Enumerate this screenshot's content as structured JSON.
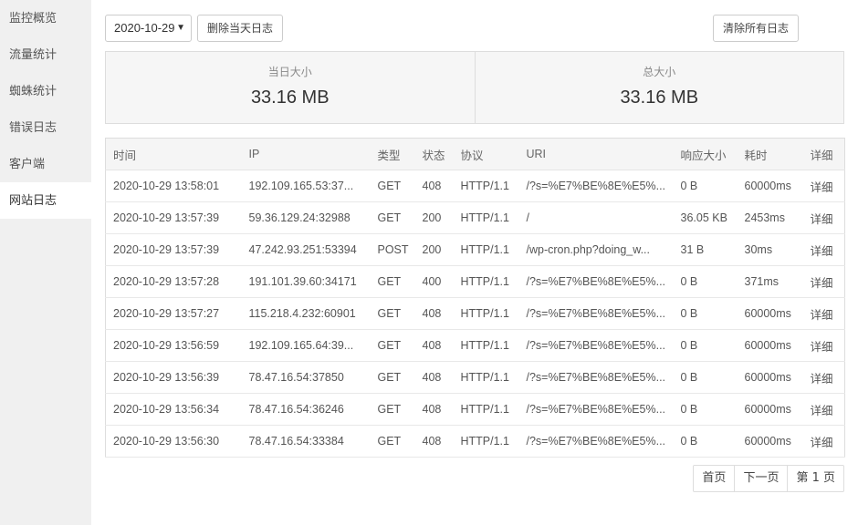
{
  "sidebar": {
    "items": [
      {
        "label": "监控概览"
      },
      {
        "label": "流量统计"
      },
      {
        "label": "蜘蛛统计"
      },
      {
        "label": "错误日志"
      },
      {
        "label": "客户端"
      },
      {
        "label": "网站日志"
      }
    ],
    "active_index": 5
  },
  "toolbar": {
    "date_value": "2020-10-29",
    "delete_today_label": "删除当天日志",
    "clear_all_label": "清除所有日志"
  },
  "stats": {
    "today_label": "当日大小",
    "today_value": "33.16 MB",
    "total_label": "总大小",
    "total_value": "33.16 MB"
  },
  "table": {
    "headers": [
      "时间",
      "IP",
      "类型",
      "状态",
      "协议",
      "URI",
      "响应大小",
      "耗时",
      "详细"
    ],
    "rows": [
      [
        "2020-10-29 13:58:01",
        "192.109.165.53:37...",
        "GET",
        "408",
        "HTTP/1.1",
        "/?s=%E7%BE%8E%E5%...",
        "0 B",
        "60000ms",
        "详细"
      ],
      [
        "2020-10-29 13:57:39",
        "59.36.129.24:32988",
        "GET",
        "200",
        "HTTP/1.1",
        "/",
        "36.05 KB",
        "2453ms",
        "详细"
      ],
      [
        "2020-10-29 13:57:39",
        "47.242.93.251:53394",
        "POST",
        "200",
        "HTTP/1.1",
        "/wp-cron.php?doing_w...",
        "31 B",
        "30ms",
        "详细"
      ],
      [
        "2020-10-29 13:57:28",
        "191.101.39.60:34171",
        "GET",
        "400",
        "HTTP/1.1",
        "/?s=%E7%BE%8E%E5%...",
        "0 B",
        "371ms",
        "详细"
      ],
      [
        "2020-10-29 13:57:27",
        "115.218.4.232:60901",
        "GET",
        "408",
        "HTTP/1.1",
        "/?s=%E7%BE%8E%E5%...",
        "0 B",
        "60000ms",
        "详细"
      ],
      [
        "2020-10-29 13:56:59",
        "192.109.165.64:39...",
        "GET",
        "408",
        "HTTP/1.1",
        "/?s=%E7%BE%8E%E5%...",
        "0 B",
        "60000ms",
        "详细"
      ],
      [
        "2020-10-29 13:56:39",
        "78.47.16.54:37850",
        "GET",
        "408",
        "HTTP/1.1",
        "/?s=%E7%BE%8E%E5%...",
        "0 B",
        "60000ms",
        "详细"
      ],
      [
        "2020-10-29 13:56:34",
        "78.47.16.54:36246",
        "GET",
        "408",
        "HTTP/1.1",
        "/?s=%E7%BE%8E%E5%...",
        "0 B",
        "60000ms",
        "详细"
      ],
      [
        "2020-10-29 13:56:30",
        "78.47.16.54:33384",
        "GET",
        "408",
        "HTTP/1.1",
        "/?s=%E7%BE%8E%E5%...",
        "0 B",
        "60000ms",
        "详细"
      ]
    ]
  },
  "pagination": {
    "first_label": "首页",
    "next_label": "下一页",
    "current_label": "第 1 页"
  },
  "colors": {
    "accent_green": "#20a53a",
    "sidebar_bg": "#f0f0f0"
  }
}
